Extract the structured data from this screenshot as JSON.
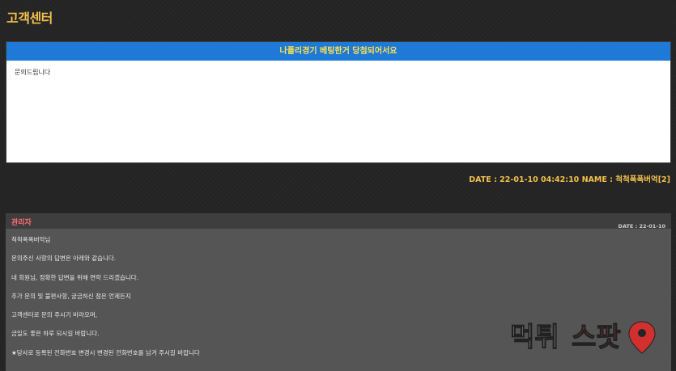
{
  "page": {
    "title": "고객센터"
  },
  "inquiry": {
    "subject": "나폴리경기 베팅한거 당첨되어서요",
    "content": "문의드립니다",
    "meta": "DATE : 22-01-10 04:42:10 NAME : 척척폭폭버억[2]"
  },
  "reply": {
    "author": "관리자",
    "date": "DATE : 22-01-10",
    "lines": [
      "척척폭폭버억님",
      "문의주신 사항의 답변은 아래와 같습니다.",
      "네 회원님, 정확한 답변을 위해 연락 드리겠습니다.",
      "추가 문의 및 불편사항, 궁금하신 점은 언제든지",
      "고객센터로 문의 주시기 바라오며,",
      "금일도 좋은 하루 되시길 바랍니다.",
      "★당사로 등록된 전화번호 변경시 변경된 전화번호를 남겨 주시길 바랍니다"
    ]
  },
  "watermark": {
    "text_left": "먹튀",
    "text_right": "스팟",
    "icon": "location-pin-icon",
    "colors": {
      "left": "#e0e0e0",
      "right": "#e02b2b"
    }
  },
  "colors": {
    "background": "#242424",
    "title": "#f2c14e",
    "header_bar": "#1e7ad6",
    "header_text": "#ffe14d",
    "reply_bg": "#555555",
    "author": "#ff6f6f"
  }
}
